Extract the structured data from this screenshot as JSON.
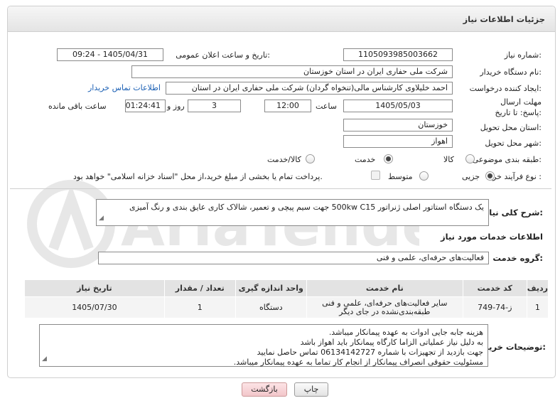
{
  "page": {
    "title": "جزئیات اطلاعات نیاز"
  },
  "fields": {
    "need_number": {
      "label": "شماره نیاز:",
      "value": "1105093985003662"
    },
    "announce_date": {
      "label": "تاریخ و ساعت اعلان عمومی:",
      "value": "1405/04/31 - 09:24"
    },
    "buyer_org": {
      "label": "نام دستگاه خریدار:",
      "value": "شرکت ملی حفاری ایران در استان خوزستان"
    },
    "requester": {
      "label": "ایجاد کننده درخواست:",
      "value": "احمد خلیلاوی کارشناس مالی(تنخواه گردان) شرکت ملی حفاری ایران در استان",
      "link": "اطلاعات تماس خریدار"
    },
    "deadline": {
      "label": "مهلت ارسال پاسخ: تا تاریخ:",
      "date": "1405/05/03",
      "time_label": "ساعت",
      "time": "12:00",
      "days": "3",
      "days_label": "روز و",
      "remaining": "01:24:41",
      "remaining_label": "ساعت باقی مانده"
    },
    "province": {
      "label": "استان محل تحویل:",
      "value": "خوزستان"
    },
    "city": {
      "label": "شهر محل تحویل:",
      "value": "اهواز"
    },
    "category": {
      "label": "طبقه بندی موضوعی:",
      "options": [
        "کالا",
        "خدمت",
        "کالا/خدمت"
      ],
      "selected": "خدمت"
    },
    "process": {
      "label": "نوع فرآیند خرید :",
      "options": [
        "جزیی",
        "متوسط"
      ],
      "selected": "جزیی",
      "payment_note": "پرداخت تمام یا بخشی از مبلغ خرید،از محل \"اسناد خزانه اسلامی\" خواهد بود."
    }
  },
  "summary": {
    "label": "شرح کلی نیاز:",
    "value": "یک دستگاه استاتور اصلی ژنراتور 500kw C15  جهت سیم پیچی و تعمیر، شالاک کاری عایق بندی و رنگ آمیزی"
  },
  "services": {
    "section_title": "اطلاعات خدمات مورد نیاز",
    "group_label": "گروه خدمت:",
    "group_value": "فعالیت‌های حرفه‌ای، علمی و فنی",
    "columns": [
      "ردیف",
      "کد خدمت",
      "نام خدمت",
      "واحد اندازه گیری",
      "تعداد / مقدار",
      "تاریخ نیاز"
    ],
    "rows": [
      {
        "row": "1",
        "code": "ز-74-749",
        "name": "سایر فعالیت‌های حرفه‌ای، علمی و فنی طبقه‌بندی‌نشده در جای دیگر",
        "unit": "دستگاه",
        "qty": "1",
        "date": "1405/07/30"
      }
    ]
  },
  "buyer_notes": {
    "label": "توضیحات خریدار:",
    "lines": [
      "هزینه جابه جایی ادوات به عهده پیمانکار میباشد.",
      "به دلیل نیاز عملیاتی الزاما کارگاه پیمانکار باید اهواز باشد",
      "جهت بازدید از تجهیزات با شماره 06134142727 تماس حاصل نمایید",
      "مسئولیت حقوقی انصراف پیمانکار از انجام کار تماما به عهده پیمانکار میباشد."
    ]
  },
  "buttons": {
    "print": "چاپ",
    "back": "بازگشت"
  },
  "watermark": "AriaTender.net",
  "colors": {
    "link": "#1a5fb4",
    "back_button_bg": "#f8d7da"
  }
}
